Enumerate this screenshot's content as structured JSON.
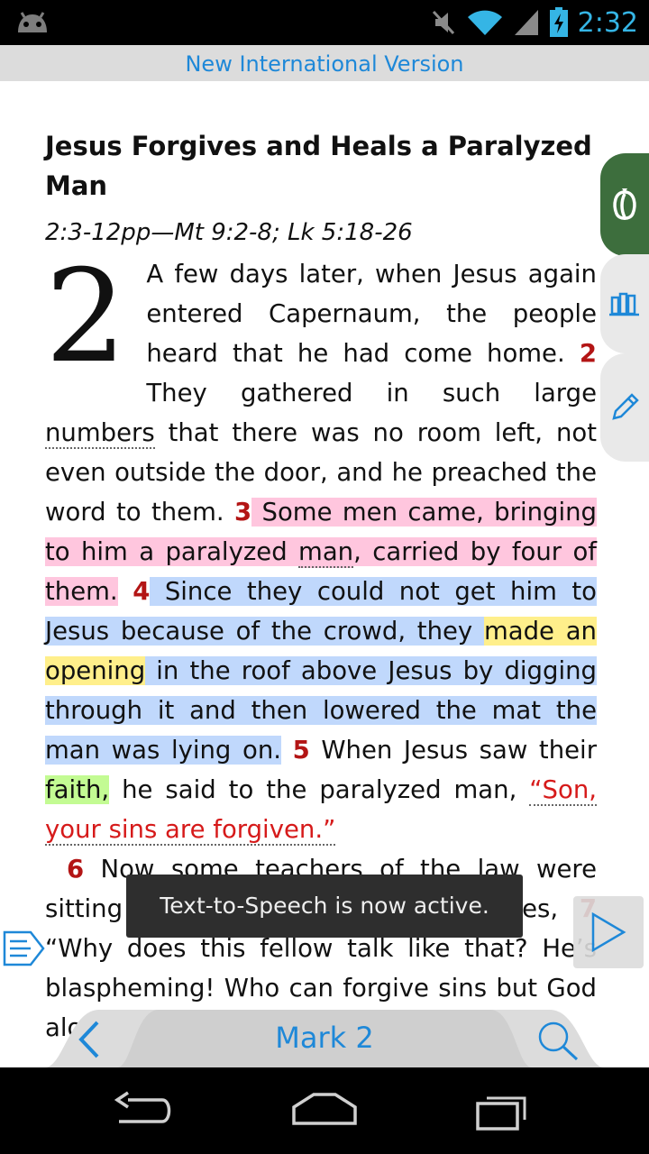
{
  "status_bar": {
    "time": "2:32",
    "icons": [
      "android-debug-icon",
      "mute-icon",
      "wifi-icon",
      "signal-icon",
      "battery-charging-icon"
    ]
  },
  "header": {
    "version": "New International Version"
  },
  "passage": {
    "heading": "Jesus Forgives and Heals a Paralyzed Man",
    "crossref": "2:3-12pp—Mt 9:2-8; Lk 5:18-26",
    "chapter": "2",
    "v1_text": "A few days later, when Jesus again entered Capernaum, the people heard that he had come home.",
    "v2_num": "2",
    "v2_a": " They gathered in such large ",
    "v2_note": "numbers",
    "v2_b": " that there was no room left, not even outside the door, and he preached the word to them. ",
    "v3_num": "3",
    "v3_a": " Some men came, bringing to him a paralyzed ",
    "v3_note": "man",
    "v3_b": ", carried by four of them.",
    "v4_num": "4",
    "v4_a": " Since they could not get him to Jesus because of the crowd, they ",
    "v4_yellow": "made an opening",
    "v4_b": " in the roof above Jesus by digging through it and then lowered the mat the man was lying on.",
    "v5_num": "5",
    "v5_a": " When Jesus saw their ",
    "v5_green": "faith,",
    "v5_b": " he said to the paralyzed man, ",
    "v5_quote": "“Son, your sins are ",
    "v5_quote_note": "forgiven",
    "v5_quote_end": ".”",
    "v6_num": "6",
    "v6_text": " Now some teachers of the law were sitting there, thinking to themselves,",
    "v7_num": "7",
    "v7_text": " “Why does this fellow talk like that? He’s blaspheming! Who can forgive sins but God alone?”"
  },
  "side_tabs": [
    {
      "name": "commentary-tab",
      "icon": "bean-icon",
      "color": "#3d6e3d"
    },
    {
      "name": "library-tab",
      "icon": "books-icon"
    },
    {
      "name": "notes-tab",
      "icon": "pencil-icon"
    }
  ],
  "toast": {
    "message": "Text-to-Speech is now active."
  },
  "chapter_nav": {
    "label": "Mark 2"
  },
  "colors": {
    "accent": "#1e88d8",
    "verse_number": "#b31515",
    "words_of_jesus": "#d61a1a"
  }
}
